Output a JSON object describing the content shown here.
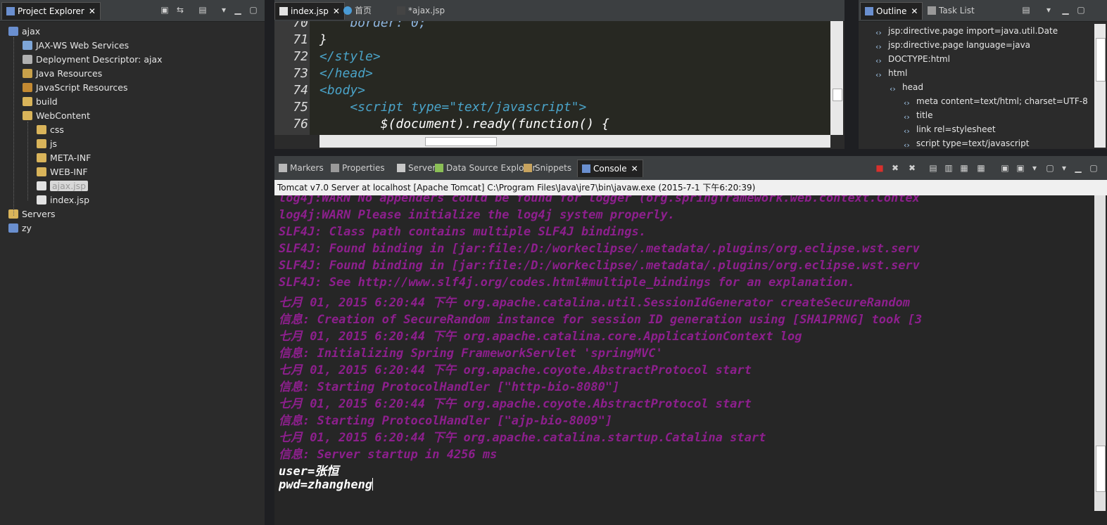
{
  "project_explorer": {
    "tab_label": "Project Explorer",
    "tree": [
      {
        "label": "ajax",
        "icon": "project-icon",
        "level": 0
      },
      {
        "label": "JAX-WS Web Services",
        "icon": "webservice-icon",
        "level": 1
      },
      {
        "label": "Deployment Descriptor: ajax",
        "icon": "descriptor-icon",
        "level": 1
      },
      {
        "label": "Java Resources",
        "icon": "java-resources-icon",
        "level": 1
      },
      {
        "label": "JavaScript Resources",
        "icon": "js-resources-icon",
        "level": 1
      },
      {
        "label": "build",
        "icon": "folder-icon",
        "level": 1
      },
      {
        "label": "WebContent",
        "icon": "folder-icon",
        "level": 1
      },
      {
        "label": "css",
        "icon": "folder-icon",
        "level": 2
      },
      {
        "label": "js",
        "icon": "folder-icon",
        "level": 2
      },
      {
        "label": "META-INF",
        "icon": "folder-icon",
        "level": 2
      },
      {
        "label": "WEB-INF",
        "icon": "folder-icon",
        "level": 2
      },
      {
        "label": "ajax.jsp",
        "icon": "file-icon",
        "level": 2,
        "selected": true
      },
      {
        "label": "index.jsp",
        "icon": "file-icon",
        "level": 2
      },
      {
        "label": "Servers",
        "icon": "folder-icon",
        "level": 0
      },
      {
        "label": "zy",
        "icon": "project-icon",
        "level": 0
      }
    ]
  },
  "editor": {
    "tabs": [
      {
        "label": "index.jsp",
        "active": true
      },
      {
        "label": "首页",
        "active": false
      },
      {
        "label": "*ajax.jsp",
        "active": false
      }
    ],
    "lines": [
      {
        "num": "70",
        "text": "    border: 0;"
      },
      {
        "num": "71",
        "text": "}"
      },
      {
        "num": "72",
        "text": "</style>"
      },
      {
        "num": "73",
        "text": "</head>"
      },
      {
        "num": "74",
        "text": "<body>"
      },
      {
        "num": "75",
        "text": "    <script type=\"text/javascript\">"
      },
      {
        "num": "76",
        "text": "        $(document).ready(function() {"
      }
    ]
  },
  "outline": {
    "tabs": [
      {
        "label": "Outline",
        "active": true
      },
      {
        "label": "Task List",
        "active": false
      }
    ],
    "items": [
      {
        "label": "jsp:directive.page import=java.util.Date",
        "level": 1
      },
      {
        "label": "jsp:directive.page language=java",
        "level": 1
      },
      {
        "label": "DOCTYPE:html",
        "level": 1
      },
      {
        "label": "html",
        "level": 1
      },
      {
        "label": "head",
        "level": 2
      },
      {
        "label": "meta content=text/html; charset=UTF-8",
        "level": 3
      },
      {
        "label": "title",
        "level": 3
      },
      {
        "label": "link rel=stylesheet",
        "level": 3
      },
      {
        "label": "script type=text/javascript",
        "level": 3
      }
    ]
  },
  "bottom": {
    "tabs": [
      {
        "label": "Markers",
        "active": false
      },
      {
        "label": "Properties",
        "active": false
      },
      {
        "label": "Servers",
        "active": false
      },
      {
        "label": "Data Source Explorer",
        "active": false
      },
      {
        "label": "Snippets",
        "active": false
      },
      {
        "label": "Console",
        "active": true
      }
    ],
    "console_title": "Tomcat v7.0 Server at localhost [Apache Tomcat] C:\\Program Files\\Java\\jre7\\bin\\javaw.exe (2015-7-1 下午6:20:39)",
    "lines": [
      {
        "text": "log4j:WARN No appenders could be found for logger (org.springframework.web.context.Contex",
        "type": "err"
      },
      {
        "text": "log4j:WARN Please initialize the log4j system properly.",
        "type": "err"
      },
      {
        "text": "SLF4J: Class path contains multiple SLF4J bindings.",
        "type": "err"
      },
      {
        "text": "SLF4J: Found binding in [jar:file:/D:/workeclipse/.metadata/.plugins/org.eclipse.wst.serv",
        "type": "err"
      },
      {
        "text": "SLF4J: Found binding in [jar:file:/D:/workeclipse/.metadata/.plugins/org.eclipse.wst.serv",
        "type": "err"
      },
      {
        "text": "SLF4J: See http://www.slf4j.org/codes.html#multiple_bindings for an explanation.",
        "type": "err"
      },
      {
        "text": "七月 01, 2015 6:20:44 下午 org.apache.catalina.util.SessionIdGenerator createSecureRandom",
        "type": "err"
      },
      {
        "text": "信息: Creation of SecureRandom instance for session ID generation using [SHA1PRNG] took [3",
        "type": "err"
      },
      {
        "text": "七月 01, 2015 6:20:44 下午 org.apache.catalina.core.ApplicationContext log",
        "type": "err"
      },
      {
        "text": "信息: Initializing Spring FrameworkServlet 'springMVC'",
        "type": "err"
      },
      {
        "text": "七月 01, 2015 6:20:44 下午 org.apache.coyote.AbstractProtocol start",
        "type": "err"
      },
      {
        "text": "信息: Starting ProtocolHandler [\"http-bio-8080\"]",
        "type": "err"
      },
      {
        "text": "七月 01, 2015 6:20:44 下午 org.apache.coyote.AbstractProtocol start",
        "type": "err"
      },
      {
        "text": "信息: Starting ProtocolHandler [\"ajp-bio-8009\"]",
        "type": "err"
      },
      {
        "text": "七月 01, 2015 6:20:44 下午 org.apache.catalina.startup.Catalina start",
        "type": "err"
      },
      {
        "text": "信息: Server startup in 4256 ms",
        "type": "err"
      },
      {
        "text": "user=张恒",
        "type": "out"
      },
      {
        "text": "pwd=zhangheng",
        "type": "out"
      }
    ]
  },
  "colors": {
    "console_err": "#8d1f8d",
    "console_out": "#ffffff",
    "tag": "#4aa3c8",
    "keyword": "#e89a2a"
  }
}
